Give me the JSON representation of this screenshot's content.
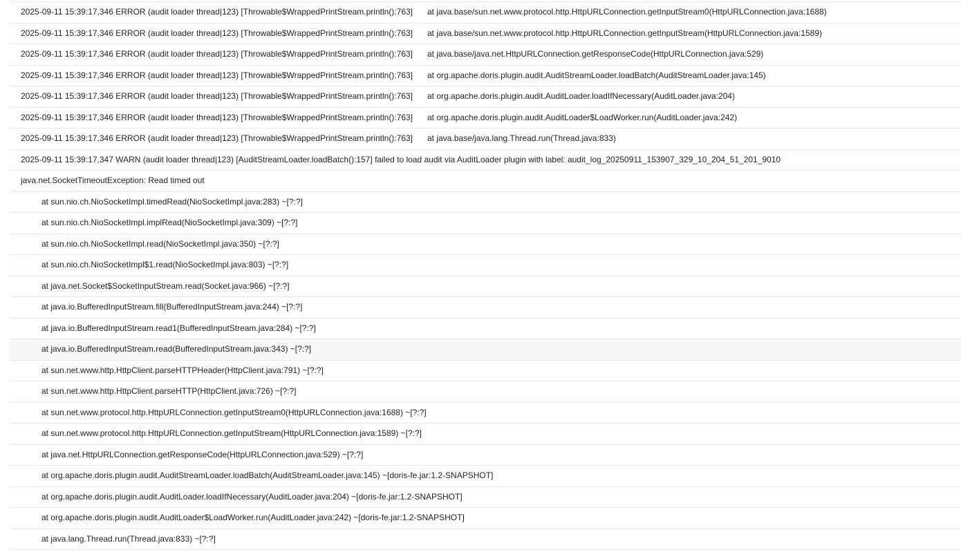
{
  "log": {
    "rows": [
      {
        "prefix": "2025-09-11 15:39:17,346 ERROR (audit loader thread|123) [Throwable$WrappedPrintStream.println():763]",
        "text": "at java.base/sun.net.www.protocol.http.HttpURLConnection.getInputStream0(HttpURLConnection.java:1688)"
      },
      {
        "prefix": "2025-09-11 15:39:17,346 ERROR (audit loader thread|123) [Throwable$WrappedPrintStream.println():763]",
        "text": "at java.base/sun.net.www.protocol.http.HttpURLConnection.getInputStream(HttpURLConnection.java:1589)"
      },
      {
        "prefix": "2025-09-11 15:39:17,346 ERROR (audit loader thread|123) [Throwable$WrappedPrintStream.println():763]",
        "text": "at java.base/java.net.HttpURLConnection.getResponseCode(HttpURLConnection.java:529)"
      },
      {
        "prefix": "2025-09-11 15:39:17,346 ERROR (audit loader thread|123) [Throwable$WrappedPrintStream.println():763]",
        "text": "at org.apache.doris.plugin.audit.AuditStreamLoader.loadBatch(AuditStreamLoader.java:145)"
      },
      {
        "prefix": "2025-09-11 15:39:17,346 ERROR (audit loader thread|123) [Throwable$WrappedPrintStream.println():763]",
        "text": "at org.apache.doris.plugin.audit.AuditLoader.loadIfNecessary(AuditLoader.java:204)"
      },
      {
        "prefix": "2025-09-11 15:39:17,346 ERROR (audit loader thread|123) [Throwable$WrappedPrintStream.println():763]",
        "text": "at org.apache.doris.plugin.audit.AuditLoader$LoadWorker.run(AuditLoader.java:242)"
      },
      {
        "prefix": "2025-09-11 15:39:17,346 ERROR (audit loader thread|123) [Throwable$WrappedPrintStream.println():763]",
        "text": "at java.base/java.lang.Thread.run(Thread.java:833)"
      },
      {
        "prefix": "2025-09-11 15:39:17,347 WARN (audit loader thread|123) [AuditStreamLoader.loadBatch():157] failed to load audit via AuditLoader plugin with label: audit_log_20250911_153907_329_10_204_51_201_9010",
        "text": ""
      },
      {
        "prefix": "java.net.SocketTimeoutException: Read timed out",
        "text": ""
      },
      {
        "prefix": "at sun.nio.ch.NioSocketImpl.timedRead(NioSocketImpl.java:283) ~[?:?]",
        "text": ""
      },
      {
        "prefix": "at sun.nio.ch.NioSocketImpl.implRead(NioSocketImpl.java:309) ~[?:?]",
        "text": ""
      },
      {
        "prefix": "at sun.nio.ch.NioSocketImpl.read(NioSocketImpl.java:350) ~[?:?]",
        "text": ""
      },
      {
        "prefix": "at sun.nio.ch.NioSocketImpl$1.read(NioSocketImpl.java:803) ~[?:?]",
        "text": ""
      },
      {
        "prefix": "at java.net.Socket$SocketInputStream.read(Socket.java:966) ~[?:?]",
        "text": ""
      },
      {
        "prefix": "at java.io.BufferedInputStream.fill(BufferedInputStream.java:244) ~[?:?]",
        "text": ""
      },
      {
        "prefix": "at java.io.BufferedInputStream.read1(BufferedInputStream.java:284) ~[?:?]",
        "text": ""
      },
      {
        "prefix": "at java.io.BufferedInputStream.read(BufferedInputStream.java:343) ~[?:?]",
        "text": ""
      },
      {
        "prefix": "at sun.net.www.http.HttpClient.parseHTTPHeader(HttpClient.java:791) ~[?:?]",
        "text": ""
      },
      {
        "prefix": "at sun.net.www.http.HttpClient.parseHTTP(HttpClient.java:726) ~[?:?]",
        "text": ""
      },
      {
        "prefix": "at sun.net.www.protocol.http.HttpURLConnection.getInputStream0(HttpURLConnection.java:1688) ~[?:?]",
        "text": ""
      },
      {
        "prefix": "at sun.net.www.protocol.http.HttpURLConnection.getInputStream(HttpURLConnection.java:1589) ~[?:?]",
        "text": ""
      },
      {
        "prefix": "at java.net.HttpURLConnection.getResponseCode(HttpURLConnection.java:529) ~[?:?]",
        "text": ""
      },
      {
        "prefix": "at org.apache.doris.plugin.audit.AuditStreamLoader.loadBatch(AuditStreamLoader.java:145) ~[doris-fe.jar:1.2-SNAPSHOT]",
        "text": ""
      },
      {
        "prefix": "at org.apache.doris.plugin.audit.AuditLoader.loadIfNecessary(AuditLoader.java:204) ~[doris-fe.jar:1.2-SNAPSHOT]",
        "text": ""
      },
      {
        "prefix": "at org.apache.doris.plugin.audit.AuditLoader$LoadWorker.run(AuditLoader.java:242) ~[doris-fe.jar:1.2-SNAPSHOT]",
        "text": ""
      },
      {
        "prefix": "at java.lang.Thread.run(Thread.java:833) ~[?:?]",
        "text": ""
      }
    ],
    "highlight_color": "#f7f8fa",
    "divider_color": "#e8e8e8"
  }
}
